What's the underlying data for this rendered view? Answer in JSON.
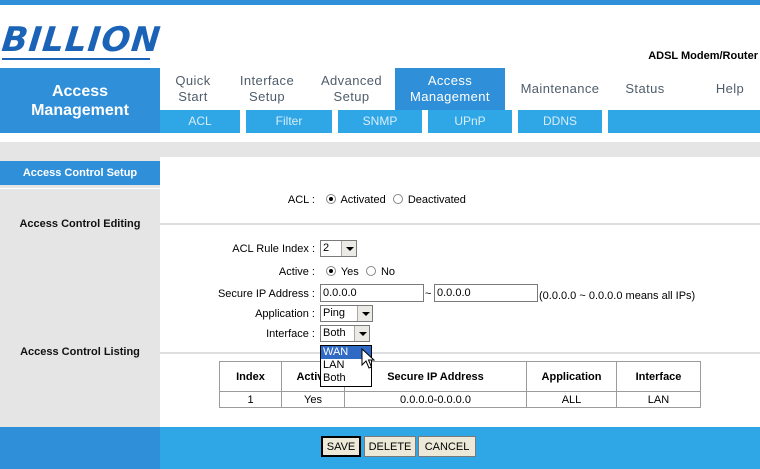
{
  "brand": {
    "logo": "BILLION",
    "model": "ADSL Modem/Router"
  },
  "section": {
    "title": "Access\nManagement"
  },
  "nav": [
    {
      "label": "Quick\nStart"
    },
    {
      "label": "Interface\nSetup"
    },
    {
      "label": "Advanced\nSetup"
    },
    {
      "label": "Access\nManagement"
    },
    {
      "label": "Maintenance"
    },
    {
      "label": "Status"
    },
    {
      "label": "Help"
    }
  ],
  "subnav": [
    {
      "label": "ACL"
    },
    {
      "label": "Filter"
    },
    {
      "label": "SNMP"
    },
    {
      "label": "UPnP"
    },
    {
      "label": "DDNS"
    }
  ],
  "left": {
    "setup": "Access Control Setup",
    "editing": "Access Control Editing",
    "listing": "Access Control Listing"
  },
  "acl": {
    "label": "ACL :",
    "activated": "Activated",
    "deactivated": "Deactivated",
    "selected": "Activated"
  },
  "form": {
    "rule_index_label": "ACL Rule Index :",
    "rule_index_value": "2",
    "active_label": "Active :",
    "active_yes": "Yes",
    "active_no": "No",
    "active_selected": "Yes",
    "secure_ip_label": "Secure IP Address :",
    "ip_start": "0.0.0.0",
    "ip_separator": "~",
    "ip_end": "0.0.0.0",
    "ip_note": "(0.0.0.0 ~ 0.0.0.0 means all IPs)",
    "application_label": "Application :",
    "application_value": "Ping",
    "interface_label": "Interface :",
    "interface_value": "Both"
  },
  "interface_dropdown": {
    "options": [
      "WAN",
      "LAN",
      "Both"
    ],
    "highlighted": "WAN"
  },
  "table": {
    "headers": [
      "Index",
      "Active",
      "Secure IP Address",
      "Application",
      "Interface"
    ],
    "rows": [
      {
        "index": "1",
        "active": "Yes",
        "ip": "0.0.0.0-0.0.0.0",
        "application": "ALL",
        "interface": "LAN"
      }
    ]
  },
  "buttons": {
    "save": "SAVE",
    "delete": "DELETE",
    "cancel": "CANCEL"
  },
  "colors": {
    "primary_blue": "#2f8fd8",
    "sub_blue": "#2fa6e6",
    "logo_blue": "#1b63b6",
    "panel_grey": "#e5e5e5"
  }
}
